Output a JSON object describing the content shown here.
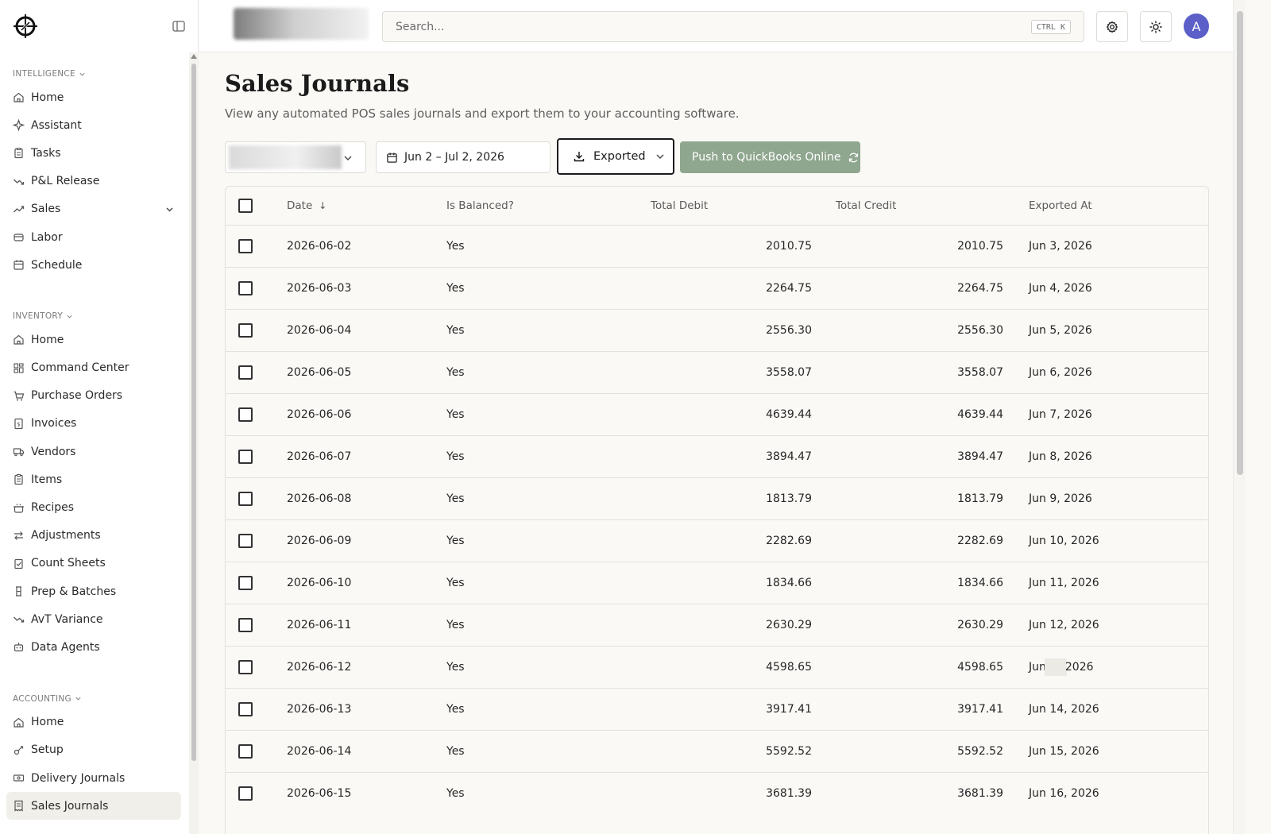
{
  "sidebar": {
    "sections": [
      {
        "label": "Intelligence",
        "items": [
          {
            "label": "Home",
            "icon": "home-icon"
          },
          {
            "label": "Assistant",
            "icon": "sparkle-icon"
          },
          {
            "label": "Tasks",
            "icon": "clipboard-icon"
          },
          {
            "label": "P&L Release",
            "icon": "trend-down-icon"
          },
          {
            "label": "Sales",
            "icon": "trend-up-icon",
            "expandable": true
          },
          {
            "label": "Labor",
            "icon": "labor-icon"
          },
          {
            "label": "Schedule",
            "icon": "calendar-icon"
          }
        ]
      },
      {
        "label": "Inventory",
        "items": [
          {
            "label": "Home",
            "icon": "home-icon"
          },
          {
            "label": "Command Center",
            "icon": "grid-icon"
          },
          {
            "label": "Purchase Orders",
            "icon": "cart-icon"
          },
          {
            "label": "Invoices",
            "icon": "invoice-icon"
          },
          {
            "label": "Vendors",
            "icon": "truck-icon"
          },
          {
            "label": "Items",
            "icon": "clipboard-icon"
          },
          {
            "label": "Recipes",
            "icon": "pot-icon"
          },
          {
            "label": "Adjustments",
            "icon": "arrows-icon"
          },
          {
            "label": "Count Sheets",
            "icon": "clipboard-check-icon"
          },
          {
            "label": "Prep & Batches",
            "icon": "prep-icon"
          },
          {
            "label": "AvT Variance",
            "icon": "trend-down-icon"
          },
          {
            "label": "Data Agents",
            "icon": "bot-icon"
          }
        ]
      },
      {
        "label": "Accounting",
        "items": [
          {
            "label": "Home",
            "icon": "home-icon"
          },
          {
            "label": "Setup",
            "icon": "setup-icon"
          },
          {
            "label": "Delivery Journals",
            "icon": "cash-icon"
          },
          {
            "label": "Sales Journals",
            "icon": "receipt-icon",
            "active": true
          }
        ]
      }
    ]
  },
  "topbar": {
    "search_placeholder": "Search...",
    "shortcut": "CTRL K",
    "avatar_initial": "A"
  },
  "page": {
    "title": "Sales Journals",
    "subtitle": "View any automated POS sales journals and export them to your accounting software."
  },
  "filters": {
    "date_range": "Jun 2 – Jul 2, 2026",
    "export_status": "Exported",
    "push_label": "Push to QuickBooks Online"
  },
  "table": {
    "headers": {
      "date": "Date",
      "balanced": "Is Balanced?",
      "debit": "Total Debit",
      "credit": "Total Credit",
      "exported": "Exported At"
    },
    "rows": [
      {
        "date": "2026-06-02",
        "balanced": "Yes",
        "debit": "2010.75",
        "credit": "2010.75",
        "exported": "Jun 3, 2026"
      },
      {
        "date": "2026-06-03",
        "balanced": "Yes",
        "debit": "2264.75",
        "credit": "2264.75",
        "exported": "Jun 4, 2026"
      },
      {
        "date": "2026-06-04",
        "balanced": "Yes",
        "debit": "2556.30",
        "credit": "2556.30",
        "exported": "Jun 5, 2026"
      },
      {
        "date": "2026-06-05",
        "balanced": "Yes",
        "debit": "3558.07",
        "credit": "3558.07",
        "exported": "Jun 6, 2026"
      },
      {
        "date": "2026-06-06",
        "balanced": "Yes",
        "debit": "4639.44",
        "credit": "4639.44",
        "exported": "Jun 7, 2026"
      },
      {
        "date": "2026-06-07",
        "balanced": "Yes",
        "debit": "3894.47",
        "credit": "3894.47",
        "exported": "Jun 8, 2026"
      },
      {
        "date": "2026-06-08",
        "balanced": "Yes",
        "debit": "1813.79",
        "credit": "1813.79",
        "exported": "Jun 9, 2026"
      },
      {
        "date": "2026-06-09",
        "balanced": "Yes",
        "debit": "2282.69",
        "credit": "2282.69",
        "exported": "Jun 10, 2026"
      },
      {
        "date": "2026-06-10",
        "balanced": "Yes",
        "debit": "1834.66",
        "credit": "1834.66",
        "exported": "Jun 11, 2026"
      },
      {
        "date": "2026-06-11",
        "balanced": "Yes",
        "debit": "2630.29",
        "credit": "2630.29",
        "exported": "Jun 12, 2026"
      },
      {
        "date": "2026-06-12",
        "balanced": "Yes",
        "debit": "4598.65",
        "credit": "4598.65",
        "exported": "Jun 13, 2026",
        "redacted": true
      },
      {
        "date": "2026-06-13",
        "balanced": "Yes",
        "debit": "3917.41",
        "credit": "3917.41",
        "exported": "Jun 14, 2026"
      },
      {
        "date": "2026-06-14",
        "balanced": "Yes",
        "debit": "5592.52",
        "credit": "5592.52",
        "exported": "Jun 15, 2026"
      },
      {
        "date": "2026-06-15",
        "balanced": "Yes",
        "debit": "3681.39",
        "credit": "3681.39",
        "exported": "Jun 16, 2026"
      }
    ]
  },
  "colors": {
    "accent_push": "#8fa68f",
    "avatar": "#5b5fc7",
    "background": "#faf9f6"
  }
}
